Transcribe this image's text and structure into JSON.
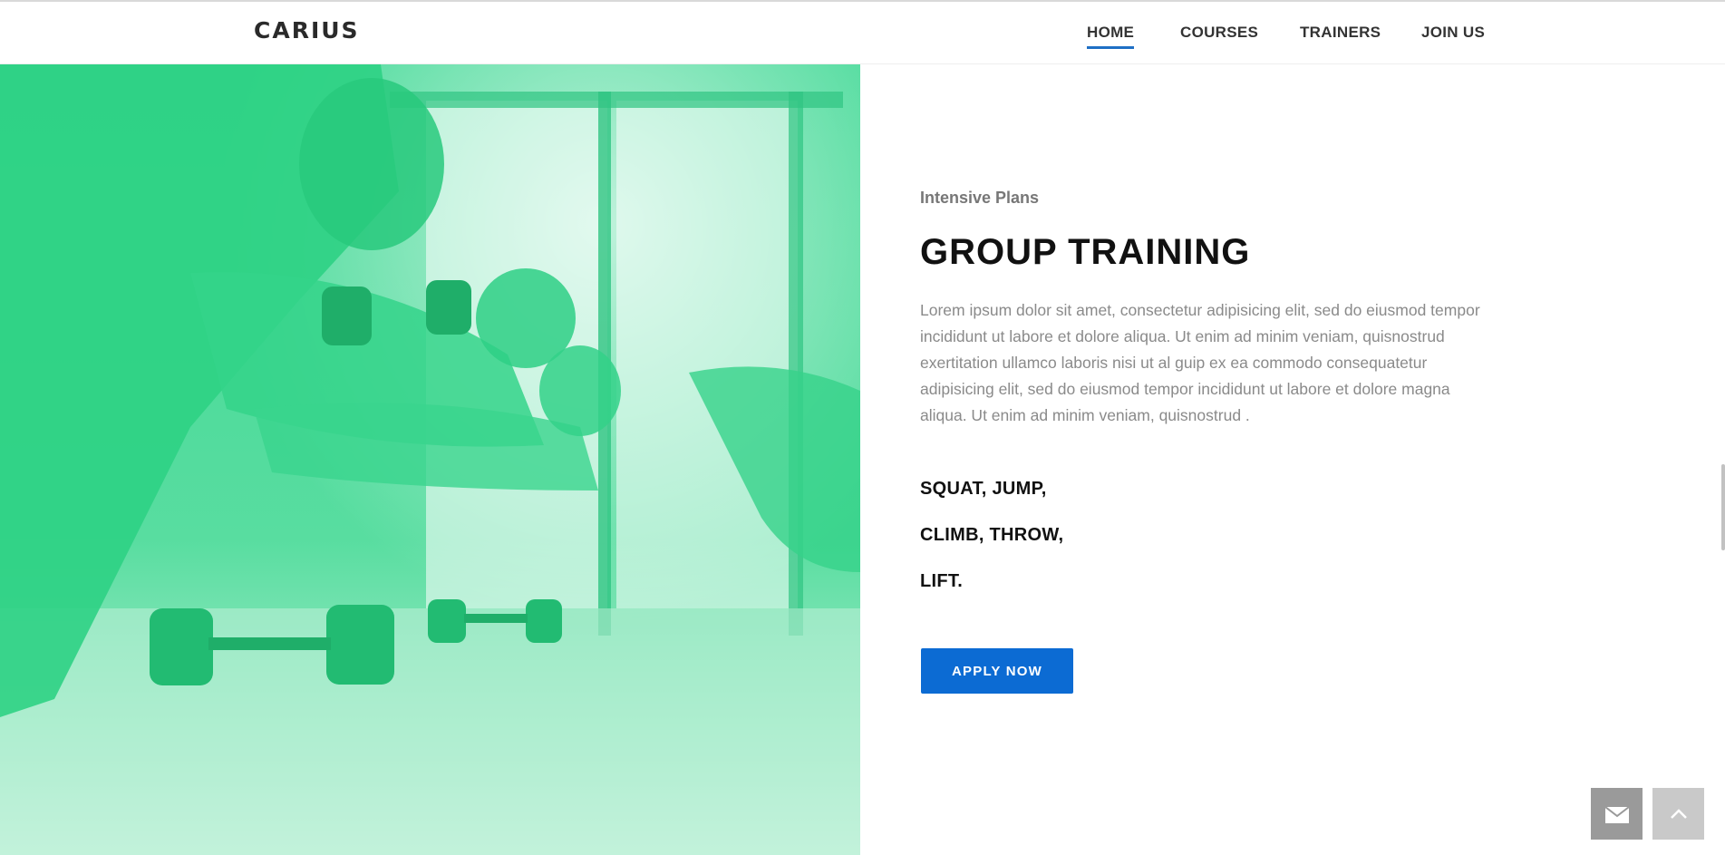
{
  "header": {
    "logo": "CARIUS",
    "nav": [
      {
        "label": "HOME",
        "active": true
      },
      {
        "label": "COURSES",
        "active": false
      },
      {
        "label": "TRAINERS",
        "active": false
      },
      {
        "label": "JOIN US",
        "active": false
      }
    ]
  },
  "section": {
    "eyebrow": "Intensive Plans",
    "title": "GROUP TRAINING",
    "body": "Lorem ipsum dolor sit amet, consectetur adipisicing elit, sed do eiusmod tempor incididunt ut labore et dolore aliqua. Ut enim ad minim veniam, quisnostrud exertitation ullamco laboris nisi ut al guip ex ea commodo consequatetur adipisicing elit, sed do eiusmod tempor incididunt ut labore et dolore magna aliqua. Ut enim ad minim veniam, quisnostrud .",
    "lines": [
      "SQUAT, JUMP,",
      "CLIMB, THROW,",
      "LIFT."
    ],
    "cta": "APPLY NOW"
  },
  "image": {
    "subject": "group-training-photo",
    "tint": "#3fd894"
  },
  "floating": {
    "mail_icon": "envelope-icon",
    "top_icon": "chevron-up-icon"
  },
  "colors": {
    "accent": "#0c6bd3",
    "nav_underline": "#1f6fc5",
    "image_tint": "#3fd894"
  }
}
